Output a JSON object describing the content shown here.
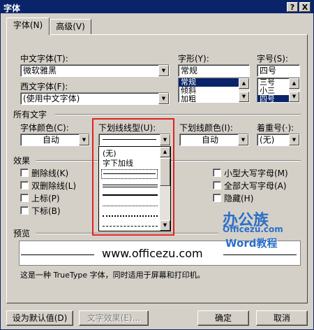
{
  "window": {
    "title": "字体",
    "help_btn": "?",
    "close_btn": "X"
  },
  "tabs": [
    {
      "label": "字体(N)",
      "active": true
    },
    {
      "label": "高级(V)",
      "active": false
    }
  ],
  "font": {
    "cn_font_label": "中文字体(T):",
    "cn_font_value": "微软雅黑",
    "west_font_label": "西文字体(F):",
    "west_font_value": "(使用中文字体)",
    "style_label": "字形(Y):",
    "style_value": "常规",
    "style_list": [
      "常规",
      "倾斜",
      "加粗"
    ],
    "style_selected": "常规",
    "size_label": "字号(S):",
    "size_value": "四号",
    "size_list": [
      "三号",
      "小三",
      "四号"
    ],
    "size_selected": "四号"
  },
  "all_text": {
    "heading": "所有文字",
    "color_label": "字体颜色(C):",
    "color_value": "自动",
    "underline_label": "下划线线型(U):",
    "underline_color_label": "下划线颜色(I):",
    "underline_color_value": "自动",
    "emphasis_label": "着重号(·):",
    "emphasis_value": "(无)"
  },
  "underline_dropdown": {
    "items": [
      "(无)",
      "字下加线"
    ],
    "line_styles": [
      "single",
      "double",
      "thick",
      "dotted",
      "dotted-heavy",
      "dashed"
    ]
  },
  "effects": {
    "heading": "效果",
    "left": [
      {
        "label": "删除线(K)",
        "checked": false
      },
      {
        "label": "双删除线(L)",
        "checked": false
      },
      {
        "label": "上标(P)",
        "checked": false
      },
      {
        "label": "下标(B)",
        "checked": false
      }
    ],
    "right": [
      {
        "label": "小型大写字母(M)",
        "checked": false
      },
      {
        "label": "全部大写字母(A)",
        "checked": false
      },
      {
        "label": "隐藏(H)",
        "checked": false
      }
    ]
  },
  "preview": {
    "heading": "预览",
    "sample_text": "www.officezu.com",
    "note": "这是一种 TrueType 字体，同时适用于屏幕和打印机。"
  },
  "watermark": {
    "brand": "办公族",
    "site": "Officezu.com",
    "tagline": "Word教程"
  },
  "buttons": {
    "set_default": "设为默认值(D)",
    "text_effects": "文字效果(E)...",
    "ok": "确定",
    "cancel": "取消"
  },
  "colors": {
    "title_bar": "#0a246a",
    "highlight_frame": "#e02020",
    "brand_blue": "#2a6fc9"
  }
}
